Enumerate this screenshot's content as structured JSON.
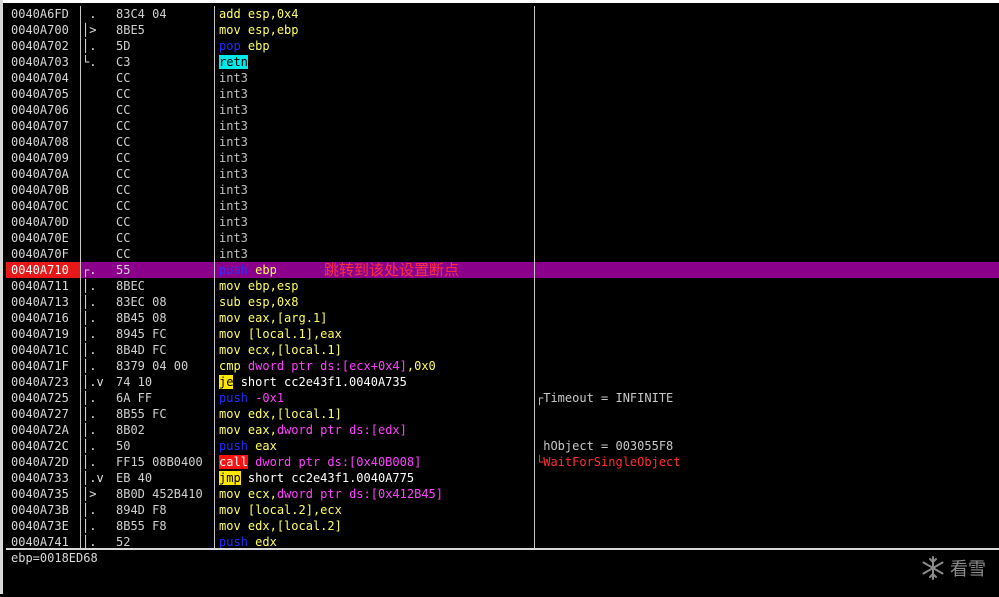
{
  "rows": [
    {
      "addr": "0040A6FD",
      "mark": " .",
      "hex": "83C4 04",
      "mn": "add",
      "ops": "esp,0x4",
      "kind": "normal"
    },
    {
      "addr": "0040A700",
      "mark": "│>",
      "hex": "8BE5",
      "mn": "mov",
      "ops": "esp,ebp",
      "kind": "normal"
    },
    {
      "addr": "0040A702",
      "mark": "│.",
      "hex": "5D",
      "mn": "pop",
      "ops": "ebp",
      "kind": "normal"
    },
    {
      "addr": "0040A703",
      "mark": "└.",
      "hex": "C3",
      "mn": "retn",
      "ops": "",
      "kind": "normal"
    },
    {
      "addr": "0040A704",
      "mark": "",
      "hex": "CC",
      "mn": "int3",
      "ops": "",
      "kind": "normal"
    },
    {
      "addr": "0040A705",
      "mark": "",
      "hex": "CC",
      "mn": "int3",
      "ops": "",
      "kind": "normal"
    },
    {
      "addr": "0040A706",
      "mark": "",
      "hex": "CC",
      "mn": "int3",
      "ops": "",
      "kind": "normal"
    },
    {
      "addr": "0040A707",
      "mark": "",
      "hex": "CC",
      "mn": "int3",
      "ops": "",
      "kind": "normal"
    },
    {
      "addr": "0040A708",
      "mark": "",
      "hex": "CC",
      "mn": "int3",
      "ops": "",
      "kind": "normal"
    },
    {
      "addr": "0040A709",
      "mark": "",
      "hex": "CC",
      "mn": "int3",
      "ops": "",
      "kind": "normal"
    },
    {
      "addr": "0040A70A",
      "mark": "",
      "hex": "CC",
      "mn": "int3",
      "ops": "",
      "kind": "normal"
    },
    {
      "addr": "0040A70B",
      "mark": "",
      "hex": "CC",
      "mn": "int3",
      "ops": "",
      "kind": "normal"
    },
    {
      "addr": "0040A70C",
      "mark": "",
      "hex": "CC",
      "mn": "int3",
      "ops": "",
      "kind": "normal"
    },
    {
      "addr": "0040A70D",
      "mark": "",
      "hex": "CC",
      "mn": "int3",
      "ops": "",
      "kind": "normal"
    },
    {
      "addr": "0040A70E",
      "mark": "",
      "hex": "CC",
      "mn": "int3",
      "ops": "",
      "kind": "normal"
    },
    {
      "addr": "0040A70F",
      "mark": "",
      "hex": "CC",
      "mn": "int3",
      "ops": "",
      "kind": "normal"
    },
    {
      "addr": "0040A710",
      "mark": "┌.",
      "hex": "55",
      "mn": "push",
      "ops": "ebp",
      "kind": "breakpoint",
      "note": "跳转到该处设置断点"
    },
    {
      "addr": "0040A711",
      "mark": "│.",
      "hex": "8BEC",
      "mn": "mov",
      "ops": "ebp,esp",
      "kind": "normal"
    },
    {
      "addr": "0040A713",
      "mark": "│.",
      "hex": "83EC 08",
      "mn": "sub",
      "ops": "esp,0x8",
      "kind": "normal"
    },
    {
      "addr": "0040A716",
      "mark": "│.",
      "hex": "8B45 08",
      "mn": "mov",
      "ops": "eax,[arg.1]",
      "kind": "normal"
    },
    {
      "addr": "0040A719",
      "mark": "│.",
      "hex": "8945 FC",
      "mn": "mov",
      "ops": "[local.1],eax",
      "kind": "normal"
    },
    {
      "addr": "0040A71C",
      "mark": "│.",
      "hex": "8B4D FC",
      "mn": "mov",
      "ops": "ecx,[local.1]",
      "kind": "normal"
    },
    {
      "addr": "0040A71F",
      "mark": "│.",
      "hex": "8379 04 00",
      "mn": "cmp",
      "ops": "dword ptr ds:[ecx+0x4],0x0",
      "kind": "normal"
    },
    {
      "addr": "0040A723",
      "mark": "│.v",
      "hex": "74 10",
      "mn": "je",
      "ops": "short cc2e43f1.0040A735",
      "kind": "normal"
    },
    {
      "addr": "0040A725",
      "mark": "│.",
      "hex": "6A FF",
      "mn": "push",
      "ops": "-0x1",
      "kind": "normal",
      "comment": "┌Timeout = INFINITE"
    },
    {
      "addr": "0040A727",
      "mark": "│.",
      "hex": "8B55 FC",
      "mn": "mov",
      "ops": "edx,[local.1]",
      "kind": "normal"
    },
    {
      "addr": "0040A72A",
      "mark": "│.",
      "hex": "8B02",
      "mn": "mov",
      "ops": "eax,dword ptr ds:[edx]",
      "kind": "normal"
    },
    {
      "addr": "0040A72C",
      "mark": "│.",
      "hex": "50",
      "mn": "push",
      "ops": "eax",
      "kind": "normal",
      "comment": " hObject = 003055F8"
    },
    {
      "addr": "0040A72D",
      "mark": "│.",
      "hex": "FF15 08B0400",
      "mn": "call",
      "ops": "dword ptr ds:[0x40B008]",
      "kind": "normal",
      "comment": "└WaitForSingleObject",
      "comment_kind": "api"
    },
    {
      "addr": "0040A733",
      "mark": "│.v",
      "hex": "EB 40",
      "mn": "jmp",
      "ops": "short cc2e43f1.0040A775",
      "kind": "normal"
    },
    {
      "addr": "0040A735",
      "mark": "│>",
      "hex": "8B0D 452B410",
      "mn": "mov",
      "ops": "ecx,dword ptr ds:[0x412B45]",
      "kind": "normal"
    },
    {
      "addr": "0040A73B",
      "mark": "│.",
      "hex": "894D F8",
      "mn": "mov",
      "ops": "[local.2],ecx",
      "kind": "normal"
    },
    {
      "addr": "0040A73E",
      "mark": "│.",
      "hex": "8B55 F8",
      "mn": "mov",
      "ops": "edx,[local.2]",
      "kind": "normal"
    },
    {
      "addr": "0040A741",
      "mark": "│.",
      "hex": "52",
      "mn": "push",
      "ops": "edx",
      "kind": "normal"
    }
  ],
  "info_pane": {
    "text": "ebp=0018ED68"
  },
  "watermark": {
    "text": "看雪",
    "icon": "snowflake-icon"
  },
  "colors": {
    "breakpoint_row": "#8b008b",
    "breakpoint_addr": "#e81818",
    "mnemonic_yellow": "#ffff60",
    "push_blue": "#2030ff",
    "retn_cyan": "#00e8e8",
    "jump_yellow": "#ffe800",
    "call_red": "#ff1010",
    "memory_magenta": "#ff40ff",
    "api_red": "#ff3030"
  }
}
